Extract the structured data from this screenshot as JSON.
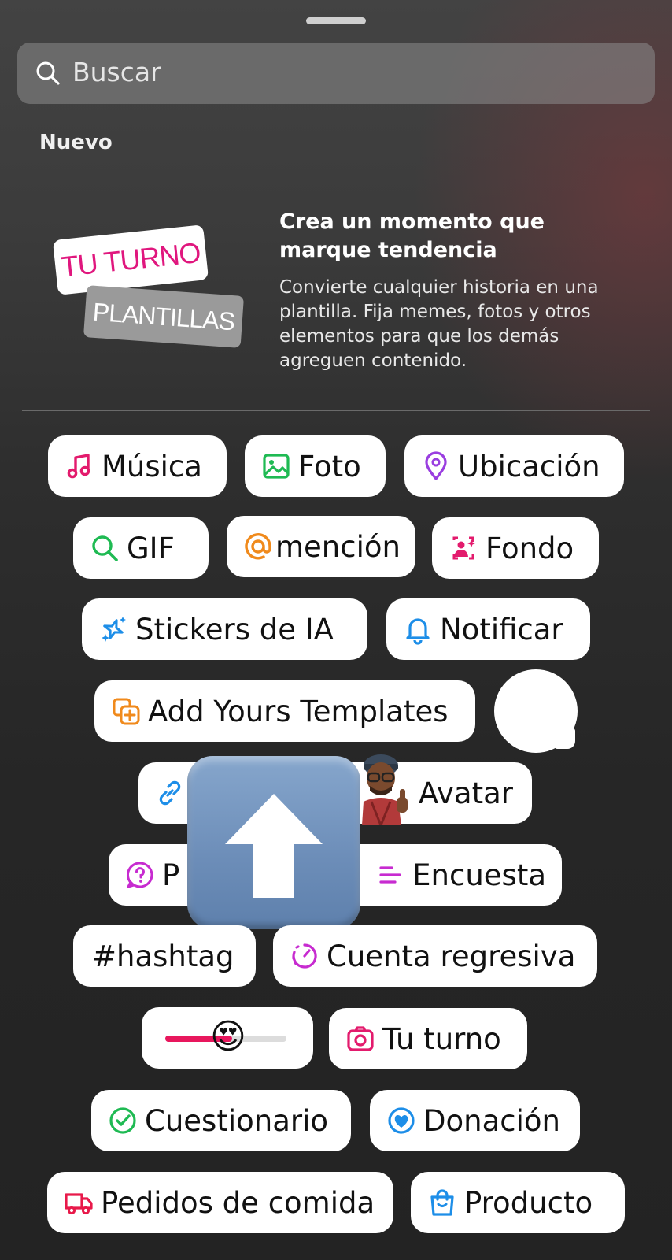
{
  "search": {
    "placeholder": "Buscar",
    "icon": "search-icon"
  },
  "section_title": "Nuevo",
  "promo": {
    "tag_primary": "TU TURNO",
    "tag_secondary": "PLANTILLAS",
    "title": "Crea un momento que marque tendencia",
    "body": "Convierte cualquier historia en una plantilla. Fija memes, fotos y otros elementos para que los demás agreguen contenido.",
    "colors": {
      "tag_primary_text": "#e0177e"
    }
  },
  "stickers": {
    "musica": "Música",
    "foto": "Foto",
    "ubicacion": "Ubicación",
    "gif": "GIF",
    "mencion": "mención",
    "fondo": "Fondo",
    "stickers_ia": "Stickers de IA",
    "notificar": "Notificar",
    "add_yours": "Add Yours Templates",
    "avatar": "Avatar",
    "pregunta_partial": "P",
    "encuesta": "Encuesta",
    "hashtag": "#hashtag",
    "cuenta_regresiva": "Cuenta regresiva",
    "tu_turno": "Tu turno",
    "cuestionario": "Cuestionario",
    "donacion": "Donación",
    "pedidos": "Pedidos de comida",
    "producto": "Producto"
  },
  "emoji_slider": {
    "emoji": "😍",
    "level_fraction": 0.55
  },
  "reaction_emoji": "😍",
  "icons": [
    "music-icon",
    "photo-icon",
    "location-pin-icon",
    "search-gif-icon",
    "threads-at-icon",
    "background-person-icon",
    "ai-sparkle-icon",
    "bell-icon",
    "add-template-icon",
    "link-icon",
    "question-icon",
    "poll-icon",
    "hashtag-icon",
    "countdown-icon",
    "camera-icon",
    "check-circle-icon",
    "donation-heart-icon",
    "food-delivery-icon",
    "shopping-bag-icon",
    "upload-arrow-icon"
  ]
}
